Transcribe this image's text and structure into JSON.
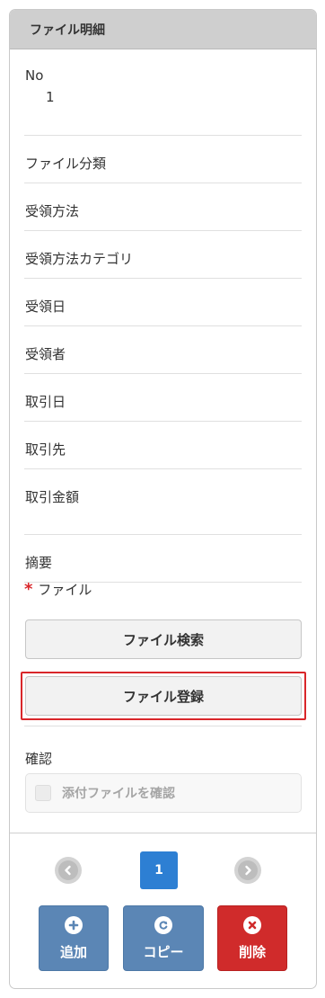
{
  "panel": {
    "title": "ファイル明細"
  },
  "fields": [
    {
      "label": "No",
      "value": "1"
    },
    {
      "label": "ファイル分類",
      "value": ""
    },
    {
      "label": "受領方法",
      "value": ""
    },
    {
      "label": "受領方法カテゴリ",
      "value": ""
    },
    {
      "label": "受領日",
      "value": ""
    },
    {
      "label": "受領者",
      "value": ""
    },
    {
      "label": "取引日",
      "value": ""
    },
    {
      "label": "取引先",
      "value": ""
    },
    {
      "label": "取引金額",
      "value": ""
    },
    {
      "label": "摘要",
      "value": ""
    }
  ],
  "file": {
    "required_mark": "*",
    "label": "ファイル",
    "search_button": "ファイル検索",
    "register_button": "ファイル登録"
  },
  "confirm": {
    "label": "確認",
    "checkbox_label": "添付ファイルを確認",
    "checked": false
  },
  "pager": {
    "current_page": "1"
  },
  "actions": {
    "add": "追加",
    "copy": "コピー",
    "delete": "削除"
  },
  "colors": {
    "header_bg": "#cfcfcf",
    "page_active": "#2d7fd3",
    "action_blue": "#5b86b5",
    "action_red": "#d02b2b",
    "required_red": "#d9262a"
  },
  "icons": {
    "prev": "chevron-left-icon",
    "next": "chevron-right-icon",
    "add": "plus-circle-icon",
    "copy": "refresh-circle-icon",
    "delete": "close-circle-icon"
  }
}
